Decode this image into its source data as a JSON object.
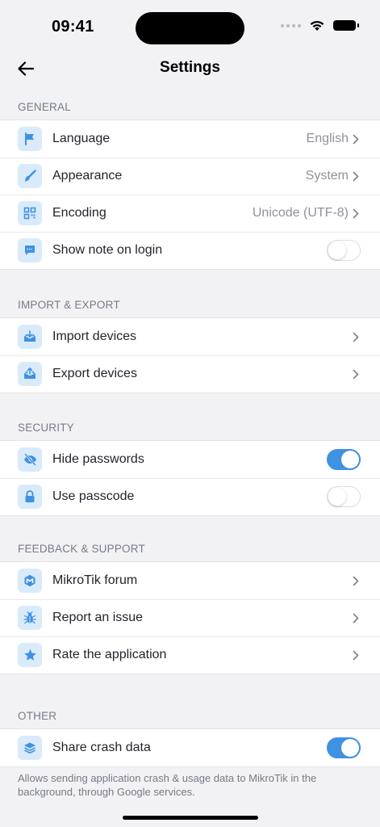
{
  "status_bar": {
    "time": "09:41"
  },
  "header": {
    "title": "Settings"
  },
  "colors": {
    "accent": "#3f91e2",
    "icon_bg": "#d9ebfb",
    "background": "#f2f2f4"
  },
  "sections": {
    "general": {
      "title": "GENERAL",
      "language": {
        "label": "Language",
        "value": "English",
        "icon": "flag-icon"
      },
      "appearance": {
        "label": "Appearance",
        "value": "System",
        "icon": "brush-icon"
      },
      "encoding": {
        "label": "Encoding",
        "value": "Unicode (UTF-8)",
        "icon": "qr-code-icon"
      },
      "show_note": {
        "label": "Show note on login",
        "on": false,
        "icon": "note-bubble-icon"
      }
    },
    "import_export": {
      "title": "IMPORT & EXPORT",
      "import": {
        "label": "Import devices",
        "icon": "tray-download-icon"
      },
      "export": {
        "label": "Export devices",
        "icon": "tray-upload-icon"
      }
    },
    "security": {
      "title": "SECURITY",
      "hide_passwords": {
        "label": "Hide passwords",
        "on": true,
        "icon": "eye-slash-icon"
      },
      "use_passcode": {
        "label": "Use passcode",
        "on": false,
        "icon": "lock-icon"
      }
    },
    "feedback": {
      "title": "FEEDBACK & SUPPORT",
      "forum": {
        "label": "MikroTik forum",
        "icon": "mikrotik-logo-icon"
      },
      "report": {
        "label": "Report an issue",
        "icon": "bug-icon"
      },
      "rate": {
        "label": "Rate the application",
        "icon": "star-icon"
      }
    },
    "other": {
      "title": "OTHER",
      "share_crash": {
        "label": "Share crash data",
        "on": true,
        "icon": "layers-icon"
      },
      "footnote": "Allows sending application crash & usage data to MikroTik in the background, through Google services."
    }
  }
}
